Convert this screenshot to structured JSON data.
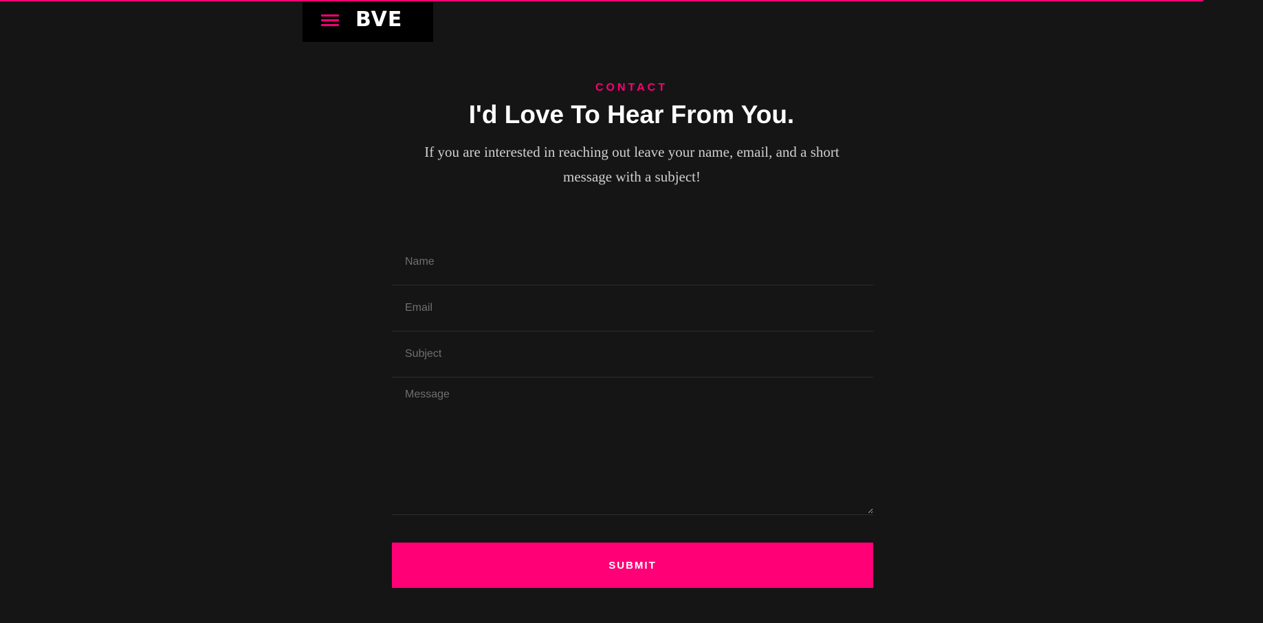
{
  "header": {
    "logo_text": "BVE",
    "menu_icon": "hamburger-icon"
  },
  "contact": {
    "kicker": "CONTACT",
    "title": "I'd Love To Hear From You.",
    "intro": "If you are interested in reaching out leave your name, email, and a short message with a subject!"
  },
  "form": {
    "name_placeholder": "Name",
    "email_placeholder": "Email",
    "subject_placeholder": "Subject",
    "message_placeholder": "Message",
    "submit_label": "SUBMIT"
  },
  "colors": {
    "background": "#151515",
    "accent": "#ff0077",
    "header_background": "#000000",
    "text": "#ffffff"
  }
}
